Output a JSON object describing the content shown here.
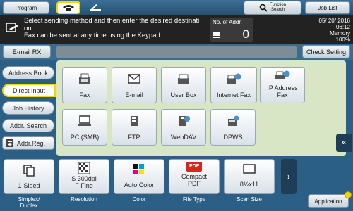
{
  "header": {
    "program_label": "Program",
    "function_search_line1": "Function",
    "function_search_line2": "Search",
    "job_list_label": "Job List"
  },
  "message": {
    "line1": "Select sending method and then enter the desired destinati",
    "line2": "on.",
    "line3": "Fax can be sent at any time using the Keypad.",
    "addr_count_label": "No. of Addr.",
    "addr_count_value": "0",
    "date": "05/ 20/ 2016",
    "time": "06:12",
    "memory_label": "Memory",
    "memory_value": "100%"
  },
  "toolbar": {
    "email_rx_label": "E-mail RX",
    "check_setting_label": "Check Setting"
  },
  "sidebar": {
    "items": [
      {
        "label": "Address Book"
      },
      {
        "label": "Direct Input"
      },
      {
        "label": "Job History"
      },
      {
        "label": "Addr. Search"
      },
      {
        "label": "Addr.Reg."
      }
    ]
  },
  "destinations": {
    "fax": "Fax",
    "email": "E-mail",
    "user_box": "User Box",
    "internet_fax": "Internet Fax",
    "ip_fax_line1": "IP Address",
    "ip_fax_line2": "Fax",
    "pc_smb": "PC (SMB)",
    "ftp": "FTP",
    "webdav": "WebDAV",
    "dpws": "DPWS"
  },
  "options": {
    "simplex": "1-Sided",
    "resolution_line1": "S 300dpi",
    "resolution_line2": "F Fine",
    "color": "Auto Color",
    "file_type_line1": "Compact",
    "file_type_line2": "PDF",
    "scan_size": "8½x11",
    "pdf_badge": "PDF"
  },
  "option_labels": {
    "simplex_line1": "Simplex/",
    "simplex_line2": "Duplex",
    "resolution": "Resolution",
    "color": "Color",
    "file_type": "File Type",
    "scan_size": "Scan Size"
  },
  "application_label": "Application",
  "colors": {
    "accent_yellow": "#f5d400",
    "panel_green": "#d8e6c6",
    "background_blue": "#2b5f86"
  }
}
